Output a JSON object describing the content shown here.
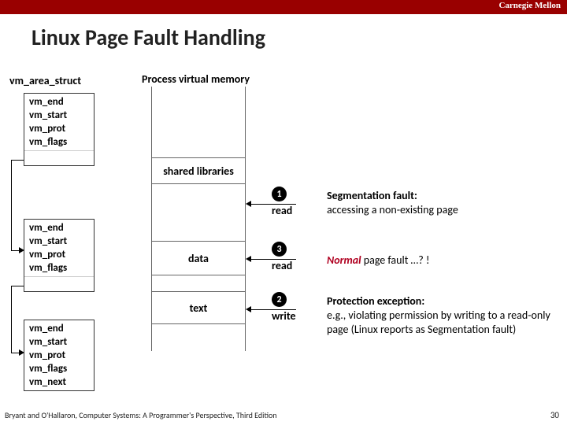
{
  "brand": "Carnegie Mellon",
  "title": "Linux Page Fault Handling",
  "labels": {
    "vm_area": "vm_area_struct",
    "pvm": "Process virtual memory"
  },
  "struct1": {
    "l0": "vm_end",
    "l1": "vm_start",
    "l2": "vm_prot",
    "l3": "vm_flags"
  },
  "struct2": {
    "l0": "vm_end",
    "l1": "vm_start",
    "l2": "vm_prot",
    "l3": "vm_flags"
  },
  "struct3": {
    "l0": "vm_end",
    "l1": "vm_start",
    "l2": "vm_prot",
    "l3": "vm_flags",
    "l4": "vm_next"
  },
  "segments": {
    "shlib": "shared libraries",
    "data": "data",
    "text": "text"
  },
  "events": {
    "e1": {
      "num": "1",
      "op": "read"
    },
    "e3": {
      "num": "3",
      "op": "read"
    },
    "e2": {
      "num": "2",
      "op": "write"
    }
  },
  "desc1": {
    "a": "Segmentation fault:",
    "b": "accessing a non-existing page"
  },
  "desc3": {
    "a": "Normal",
    "b": " page fault …? !"
  },
  "desc2": {
    "a": "Protection exception:",
    "b": "e.g., violating permission by writing to a read-only page (Linux reports as Segmentation fault)"
  },
  "footer": "Bryant and O'Hallaron, Computer Systems: A Programmer's Perspective, Third Edition",
  "pagenum": "30"
}
